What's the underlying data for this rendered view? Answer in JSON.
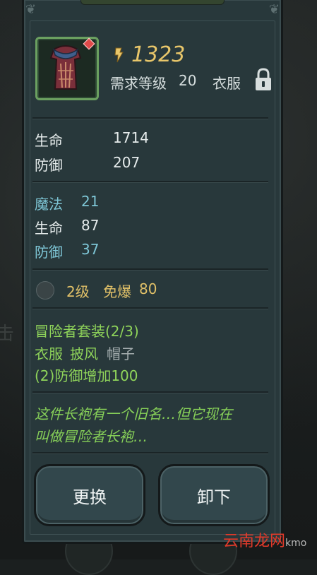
{
  "item": {
    "icon": "robe-icon",
    "rarity_color": "#6ba060",
    "power": "1323",
    "required_level_label": "需求等级",
    "required_level": "20",
    "type": "衣服",
    "locked": true
  },
  "base_stats": [
    {
      "label": "生命",
      "value": "1714"
    },
    {
      "label": "防御",
      "value": "207"
    }
  ],
  "bonus_stats": [
    {
      "label": "魔法",
      "value": "21",
      "color": "cyan"
    },
    {
      "label": "生命",
      "value": "87",
      "color": "white"
    },
    {
      "label": "防御",
      "value": "37",
      "color": "cyan"
    }
  ],
  "rune": {
    "level": "2级",
    "effect": "免爆",
    "value": "80"
  },
  "set": {
    "name": "冒险者套装(2/3)",
    "pieces": [
      {
        "name": "衣服",
        "owned": true
      },
      {
        "name": "披风",
        "owned": true
      },
      {
        "name": "帽子",
        "owned": false
      }
    ],
    "bonus": "(2)防御增加100"
  },
  "flavor": {
    "line1": "这件长袍有一个旧名…但它现在",
    "line2": "叫做冒险者长袍…"
  },
  "buttons": {
    "replace": "更换",
    "unequip": "卸下"
  },
  "watermark": {
    "brand": "云南龙网",
    "suffix": "kmo"
  },
  "colors": {
    "power": "#e8c66a",
    "cyan_stat": "#7ec6d6",
    "set_green": "#8fd45a",
    "panel": "#28383b"
  }
}
